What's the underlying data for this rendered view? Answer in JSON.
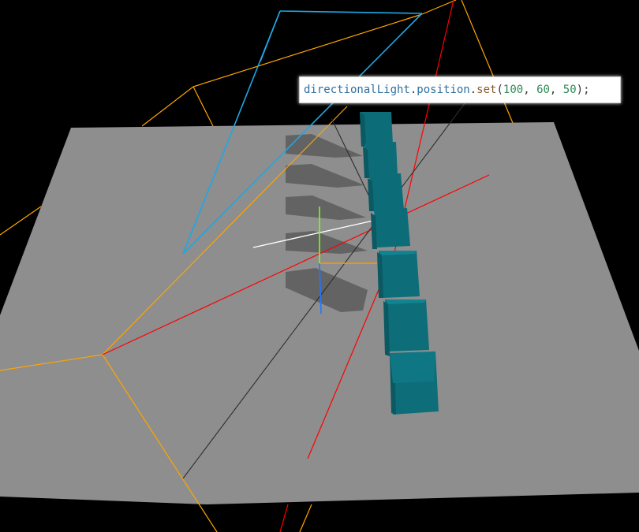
{
  "code_tooltip": {
    "object": "directionalLight",
    "dot1": ".",
    "property": "position",
    "dot2": ".",
    "method": "set",
    "open_paren": "(",
    "arg_x": "100",
    "sep1": ", ",
    "arg_y": "60",
    "sep2": ", ",
    "arg_z": "50",
    "close": ");"
  },
  "scene": {
    "background_color": "#000000",
    "ground_color": "#8e8e8e",
    "cube_color": "#0e6d78",
    "cube_count": 7,
    "shadow_count": 5,
    "camera_helper_color": "#ffa500",
    "light_frustum_color": "#1ea7e6",
    "light_ray_color": "#ff0000",
    "light_target_line_color": "#333333",
    "light_direction_color": "#ffffff",
    "axis_colors": {
      "x": "#ff6600",
      "y": "#7fff00",
      "z": "#2277ff"
    }
  }
}
